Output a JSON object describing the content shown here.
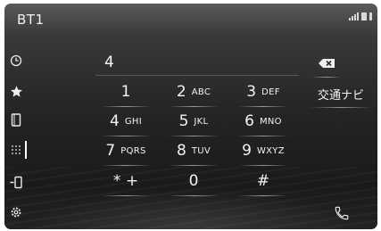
{
  "header": {
    "device_name": "BT1"
  },
  "sidebar": {
    "items": [
      {
        "name": "history-icon"
      },
      {
        "name": "favorites-star-icon"
      },
      {
        "name": "contacts-icon"
      },
      {
        "name": "keypad-icon",
        "active": true
      },
      {
        "name": "phone-transfer-icon"
      },
      {
        "name": "settings-gear-icon"
      }
    ]
  },
  "dialpad": {
    "entered_number": "4",
    "keys": [
      {
        "num": "1",
        "letters": ""
      },
      {
        "num": "2",
        "letters": "ABC"
      },
      {
        "num": "3",
        "letters": "DEF"
      },
      {
        "num": "4",
        "letters": "GHI"
      },
      {
        "num": "5",
        "letters": "JKL"
      },
      {
        "num": "6",
        "letters": "MNO"
      },
      {
        "num": "7",
        "letters": "PQRS"
      },
      {
        "num": "8",
        "letters": "TUV"
      },
      {
        "num": "9",
        "letters": "WXYZ"
      },
      {
        "num": "* +",
        "letters": ""
      },
      {
        "num": "0",
        "letters": ""
      },
      {
        "num": "#",
        "letters": ""
      }
    ]
  },
  "right_panel": {
    "backspace_icon": "backspace-icon",
    "nav_label": "交通ナビ",
    "call_icon": "call-handset-icon"
  },
  "colors": {
    "background_top": "#5a5a5a",
    "background_bottom": "#1a1a1a",
    "text": "#f3f3f3"
  }
}
